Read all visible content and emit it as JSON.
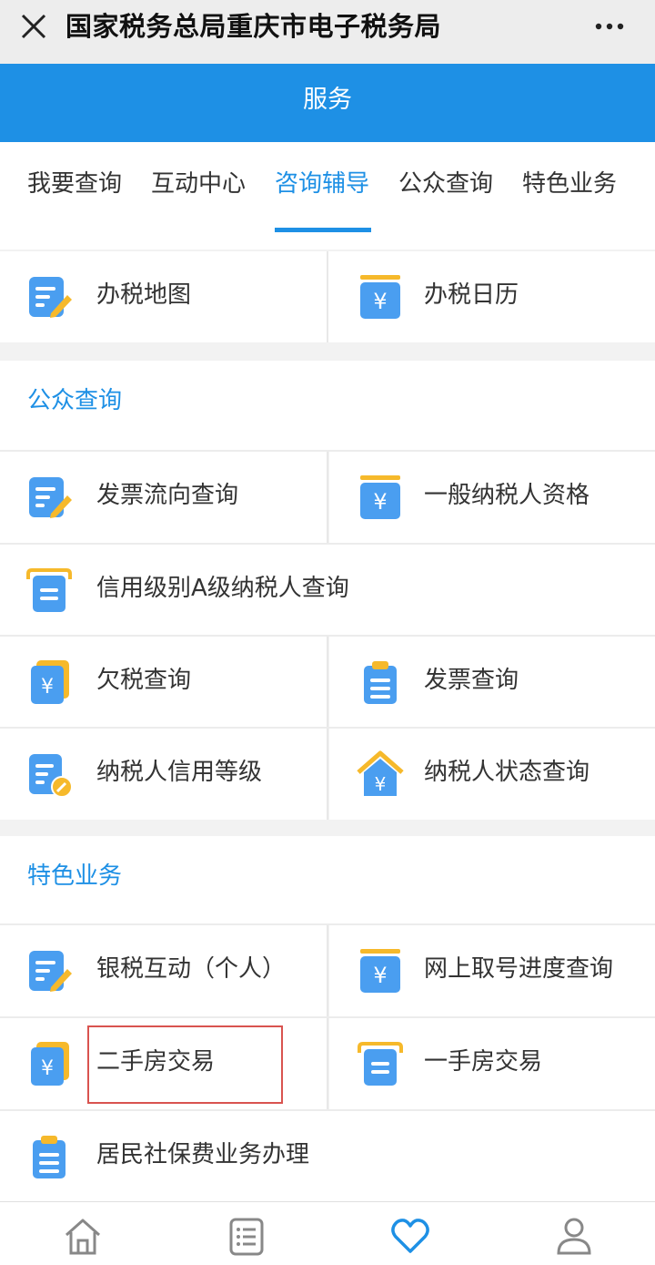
{
  "window": {
    "title": "国家税务总局重庆市电子税务局",
    "close_icon": "close-icon",
    "more_icon": "more-dots-icon"
  },
  "header": {
    "title": "服务"
  },
  "tabs": [
    {
      "label": "我要查询"
    },
    {
      "label": "互动中心"
    },
    {
      "label": "咨询辅导",
      "active": true
    },
    {
      "label": "公众查询"
    },
    {
      "label": "特色业务"
    }
  ],
  "top_items": [
    {
      "label": "办税地图",
      "icon": "edit-form-icon"
    },
    {
      "label": "办税日历",
      "icon": "yuan-calendar-icon"
    }
  ],
  "public_query": {
    "title": "公众查询",
    "items": [
      {
        "label": "发票流向查询",
        "icon": "edit-form-icon"
      },
      {
        "label": "一般纳税人资格",
        "icon": "yuan-calendar-icon"
      },
      {
        "label": "信用级别A级纳税人查询",
        "icon": "document-tray-icon"
      },
      {
        "label": "欠税查询",
        "icon": "yuan-card-icon"
      },
      {
        "label": "发票查询",
        "icon": "clipboard-icon"
      },
      {
        "label": "纳税人信用等级",
        "icon": "doc-badge-icon"
      },
      {
        "label": "纳税人状态查询",
        "icon": "yuan-house-icon"
      }
    ]
  },
  "special": {
    "title": "特色业务",
    "items": [
      {
        "label": "银税互动（个人）",
        "icon": "edit-form-icon"
      },
      {
        "label": "网上取号进度查询",
        "icon": "yuan-calendar-icon"
      },
      {
        "label": "二手房交易",
        "icon": "yuan-card-icon",
        "highlighted": true
      },
      {
        "label": "一手房交易",
        "icon": "document-tray-icon"
      },
      {
        "label": "居民社保费业务办理",
        "icon": "clipboard-icon"
      }
    ]
  },
  "bottom_nav": [
    {
      "icon": "home-icon"
    },
    {
      "icon": "list-icon"
    },
    {
      "icon": "heart-icon",
      "active": true
    },
    {
      "icon": "user-icon"
    }
  ],
  "colors": {
    "accent": "#1e90e5",
    "icon_blue": "#4a9ef0",
    "icon_yellow": "#f6b92b",
    "highlight_box": "#d9534f"
  }
}
